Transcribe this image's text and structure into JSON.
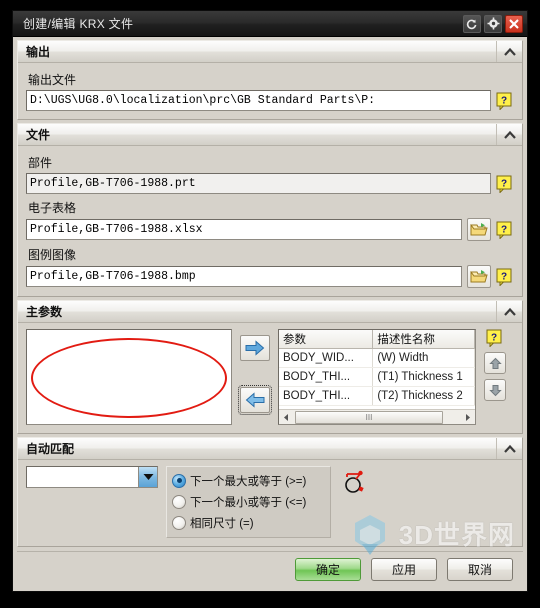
{
  "window": {
    "title": "创建/编辑 KRX 文件",
    "titlebar_buttons": [
      {
        "name": "reset-icon",
        "tip": "reset"
      },
      {
        "name": "gear-icon",
        "tip": "settings"
      },
      {
        "name": "close-icon",
        "tip": "close"
      }
    ]
  },
  "sections": {
    "output": {
      "header": "输出",
      "file_label": "输出文件",
      "file_value": "D:\\UGS\\UG8.0\\localization\\prc\\GB Standard Parts\\P:",
      "help": "?"
    },
    "files": {
      "header": "文件",
      "part_label": "部件",
      "part_value": "Profile,GB-T706-1988.prt",
      "spreadsheet_label": "电子表格",
      "spreadsheet_value": "Profile,GB-T706-1988.xlsx",
      "image_label": "图例图像",
      "image_value": "Profile,GB-T706-1988.bmp",
      "help": "?"
    },
    "main_params": {
      "header": "主参数",
      "help": "?",
      "table": {
        "columns": [
          "参数",
          "描述性名称"
        ],
        "rows": [
          [
            "BODY_WID...",
            "(W) Width"
          ],
          [
            "BODY_THI...",
            "(T1) Thickness 1"
          ],
          [
            "BODY_THI...",
            "(T2) Thickness 2"
          ]
        ]
      },
      "scroll_grip": "III"
    },
    "auto_match": {
      "header": "自动匹配",
      "combo_value": "",
      "options": [
        {
          "label": "下一个最大或等于 (>=)",
          "selected": true
        },
        {
          "label": "下一个最小或等于 (<=)",
          "selected": false
        },
        {
          "label": "相同尺寸 (=)",
          "selected": false
        }
      ]
    }
  },
  "footer": {
    "ok": "确定",
    "apply": "应用",
    "cancel": "取消"
  },
  "watermark": {
    "text": "3D世界网"
  },
  "colors": {
    "accent_red": "#e21b12",
    "primary_green": "#6fc555",
    "dialog_bg": "#d6d2ca",
    "title_bg": "#202020"
  }
}
